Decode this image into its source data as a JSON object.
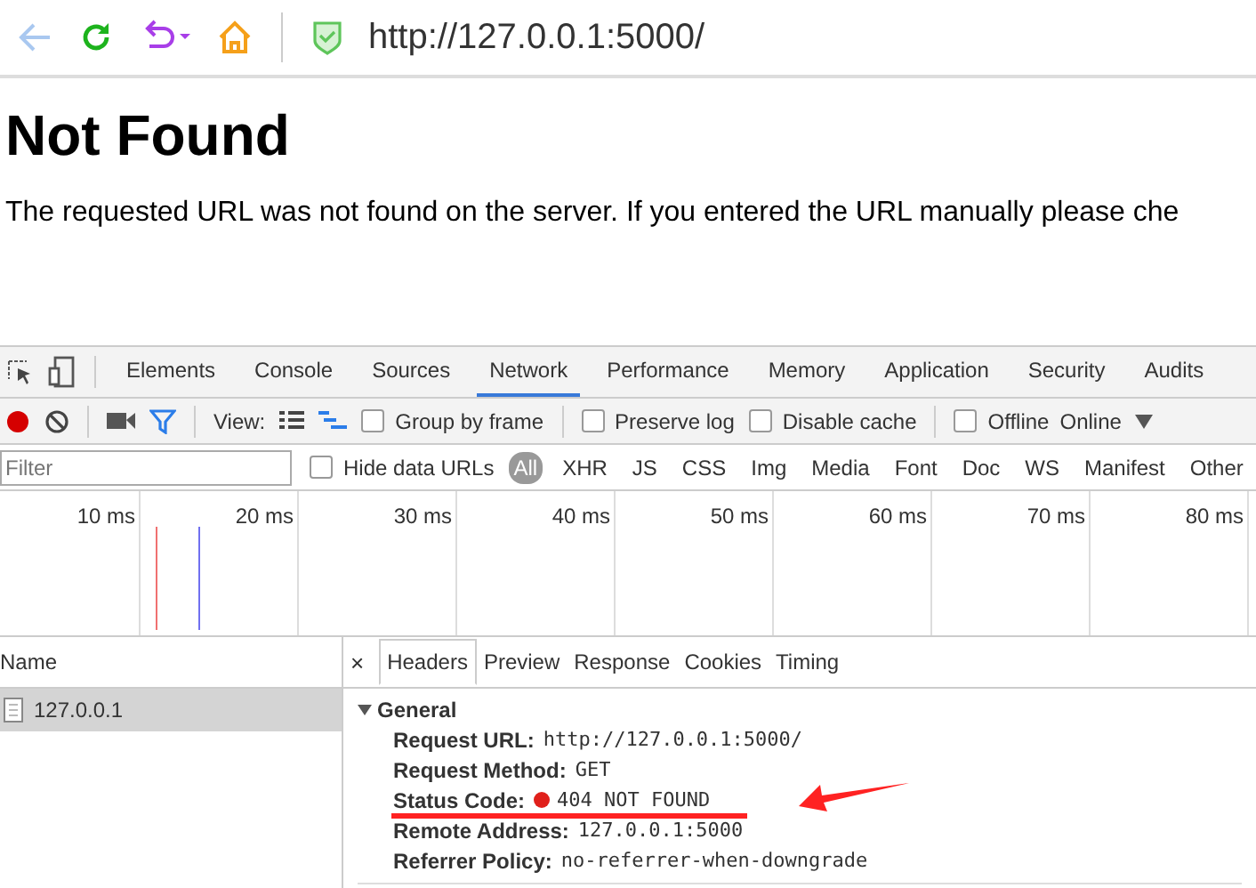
{
  "browser": {
    "url": "http://127.0.0.1:5000/"
  },
  "page": {
    "heading": "Not Found",
    "message": "The requested URL was not found on the server. If you entered the URL manually please che"
  },
  "devtools": {
    "tabs": [
      {
        "label": "Elements",
        "selected": false
      },
      {
        "label": "Console",
        "selected": false
      },
      {
        "label": "Sources",
        "selected": false
      },
      {
        "label": "Network",
        "selected": true
      },
      {
        "label": "Performance",
        "selected": false
      },
      {
        "label": "Memory",
        "selected": false
      },
      {
        "label": "Application",
        "selected": false
      },
      {
        "label": "Security",
        "selected": false
      },
      {
        "label": "Audits",
        "selected": false
      }
    ],
    "recording": true,
    "view_label": "View:",
    "options": [
      {
        "label": "Group by frame",
        "checked": false
      },
      {
        "label": "Preserve log",
        "checked": false
      },
      {
        "label": "Disable cache",
        "checked": false
      },
      {
        "label": "Offline",
        "checked": false
      }
    ],
    "throttle": "Online",
    "filter": {
      "placeholder": "Filter",
      "hide_data_urls": {
        "label": "Hide data URLs",
        "checked": false
      },
      "types": [
        {
          "label": "All",
          "selected": true
        },
        {
          "label": "XHR",
          "selected": false
        },
        {
          "label": "JS",
          "selected": false
        },
        {
          "label": "CSS",
          "selected": false
        },
        {
          "label": "Img",
          "selected": false
        },
        {
          "label": "Media",
          "selected": false
        },
        {
          "label": "Font",
          "selected": false
        },
        {
          "label": "Doc",
          "selected": false
        },
        {
          "label": "WS",
          "selected": false
        },
        {
          "label": "Manifest",
          "selected": false
        },
        {
          "label": "Other",
          "selected": false
        }
      ]
    },
    "timeline_ticks": [
      "10 ms",
      "20 ms",
      "30 ms",
      "40 ms",
      "50 ms",
      "60 ms",
      "70 ms",
      "80 ms"
    ],
    "requests": {
      "column": "Name",
      "rows": [
        {
          "name": "127.0.0.1",
          "selected": true
        }
      ]
    },
    "detail_close": "×",
    "detail_tabs": [
      {
        "label": "Headers",
        "selected": true
      },
      {
        "label": "Preview",
        "selected": false
      },
      {
        "label": "Response",
        "selected": false
      },
      {
        "label": "Cookies",
        "selected": false
      },
      {
        "label": "Timing",
        "selected": false
      }
    ],
    "general": {
      "title": "General",
      "expanded": true,
      "headers": [
        {
          "key": "Request URL:",
          "value": "http://127.0.0.1:5000/"
        },
        {
          "key": "Request Method:",
          "value": "GET"
        },
        {
          "key": "Status Code:",
          "value": "404 NOT FOUND",
          "color": "#e0201b"
        },
        {
          "key": "Remote Address:",
          "value": "127.0.0.1:5000"
        },
        {
          "key": "Referrer Policy:",
          "value": "no-referrer-when-downgrade"
        }
      ]
    }
  }
}
